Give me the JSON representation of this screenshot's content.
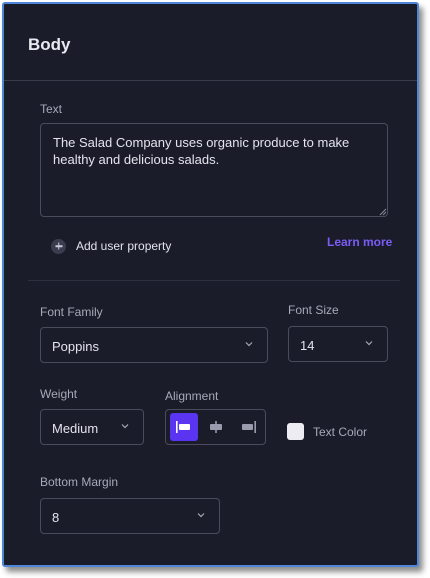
{
  "panel": {
    "title": "Body"
  },
  "text_field": {
    "label": "Text",
    "value": "The Salad Company uses organic produce to make healthy and delicious salads."
  },
  "add_user_property": {
    "label": "Add user property",
    "icon": "plus-circle-icon"
  },
  "learn_more": {
    "label": "Learn more",
    "color": "#7a5cf5"
  },
  "font_family": {
    "label": "Font Family",
    "value": "Poppins"
  },
  "font_size": {
    "label": "Font Size",
    "value": "14"
  },
  "weight": {
    "label": "Weight",
    "value": "Medium"
  },
  "alignment": {
    "label": "Alignment",
    "options": [
      "left",
      "center",
      "right"
    ],
    "selected": "left",
    "active_color": "#5b34f2"
  },
  "text_color": {
    "label": "Text Color",
    "swatch": "#ececf2"
  },
  "bottom_margin": {
    "label": "Bottom Margin",
    "value": "8"
  },
  "colors": {
    "panel_bg": "#1b1c2a",
    "frame_border": "#4f86d8"
  }
}
